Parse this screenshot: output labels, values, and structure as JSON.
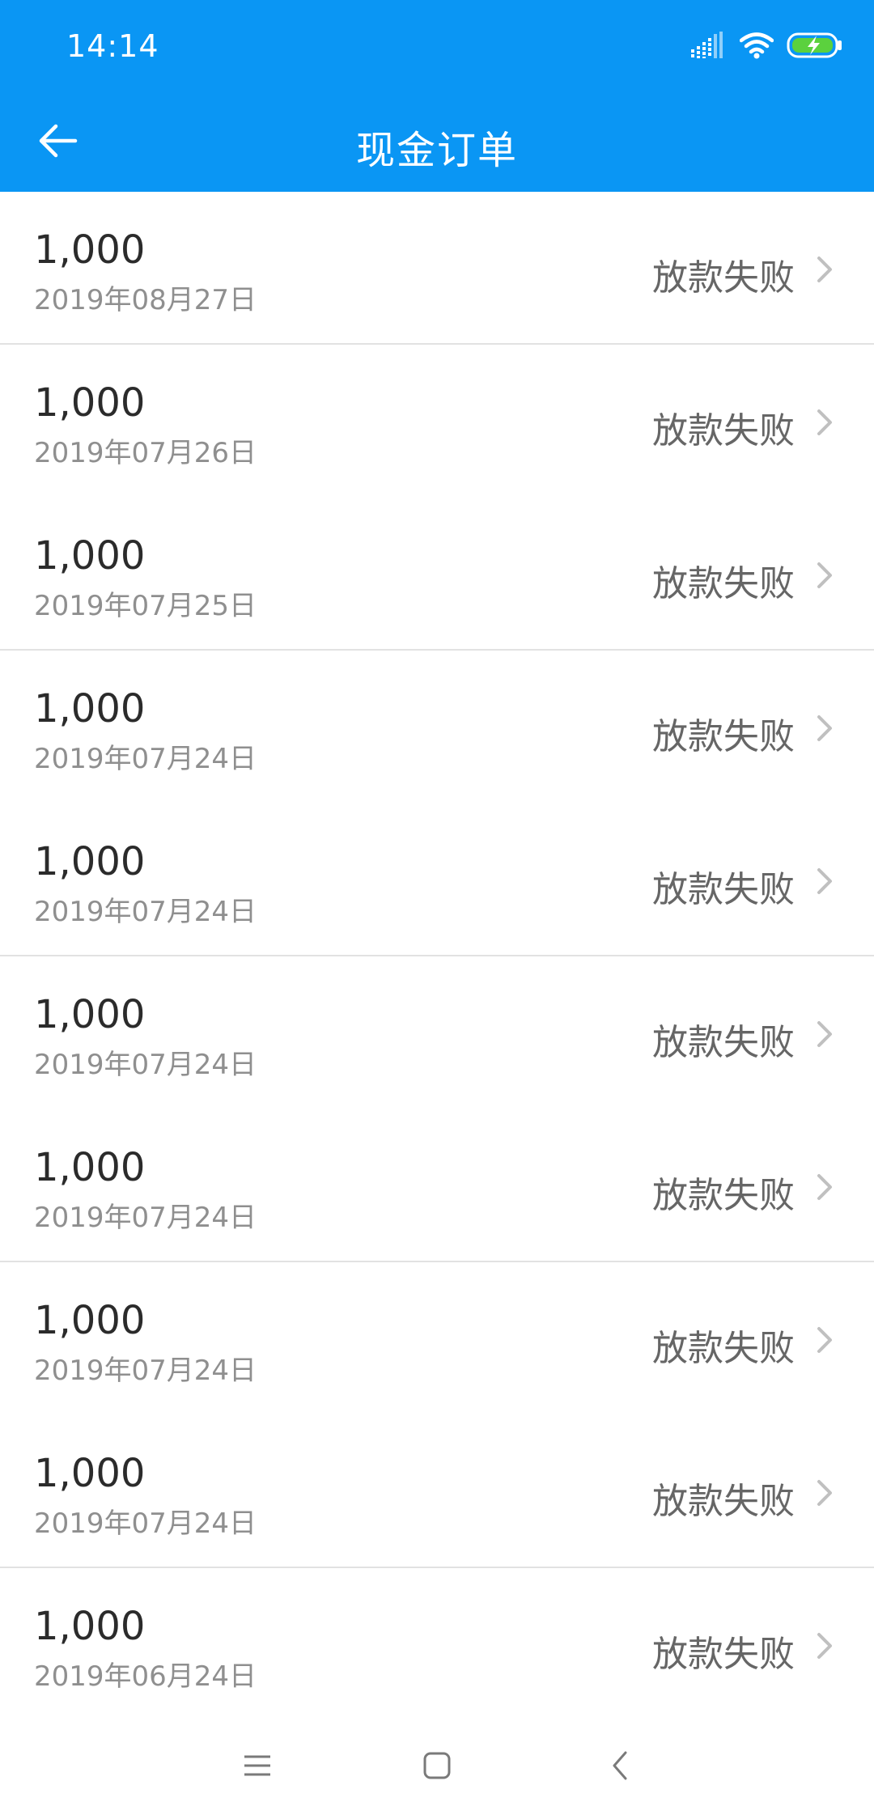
{
  "status_bar": {
    "time": "14:14",
    "icons": [
      "signal-icon",
      "wifi-icon",
      "battery-charging-icon"
    ]
  },
  "toolbar": {
    "back_icon": "arrow-left-icon",
    "title": "现金订单"
  },
  "colors": {
    "header_bg": "#0a96f4",
    "amount_text": "#2b2b2b",
    "date_text": "#8f8f8f",
    "status_text": "#666666",
    "divider": "#e2e2e2",
    "battery_fill": "#5bd13e"
  },
  "orders": [
    {
      "amount": "1,000",
      "date": "2019年08月27日",
      "status": "放款失败"
    },
    {
      "amount": "1,000",
      "date": "2019年07月26日",
      "status": "放款失败"
    },
    {
      "amount": "1,000",
      "date": "2019年07月25日",
      "status": "放款失败"
    },
    {
      "amount": "1,000",
      "date": "2019年07月24日",
      "status": "放款失败"
    },
    {
      "amount": "1,000",
      "date": "2019年07月24日",
      "status": "放款失败"
    },
    {
      "amount": "1,000",
      "date": "2019年07月24日",
      "status": "放款失败"
    },
    {
      "amount": "1,000",
      "date": "2019年07月24日",
      "status": "放款失败"
    },
    {
      "amount": "1,000",
      "date": "2019年07月24日",
      "status": "放款失败"
    },
    {
      "amount": "1,000",
      "date": "2019年07月24日",
      "status": "放款失败"
    },
    {
      "amount": "1,000",
      "date": "2019年06月24日",
      "status": "放款失败"
    }
  ],
  "nav_bar": {
    "icons": [
      "menu-icon",
      "home-icon",
      "back-icon"
    ]
  }
}
